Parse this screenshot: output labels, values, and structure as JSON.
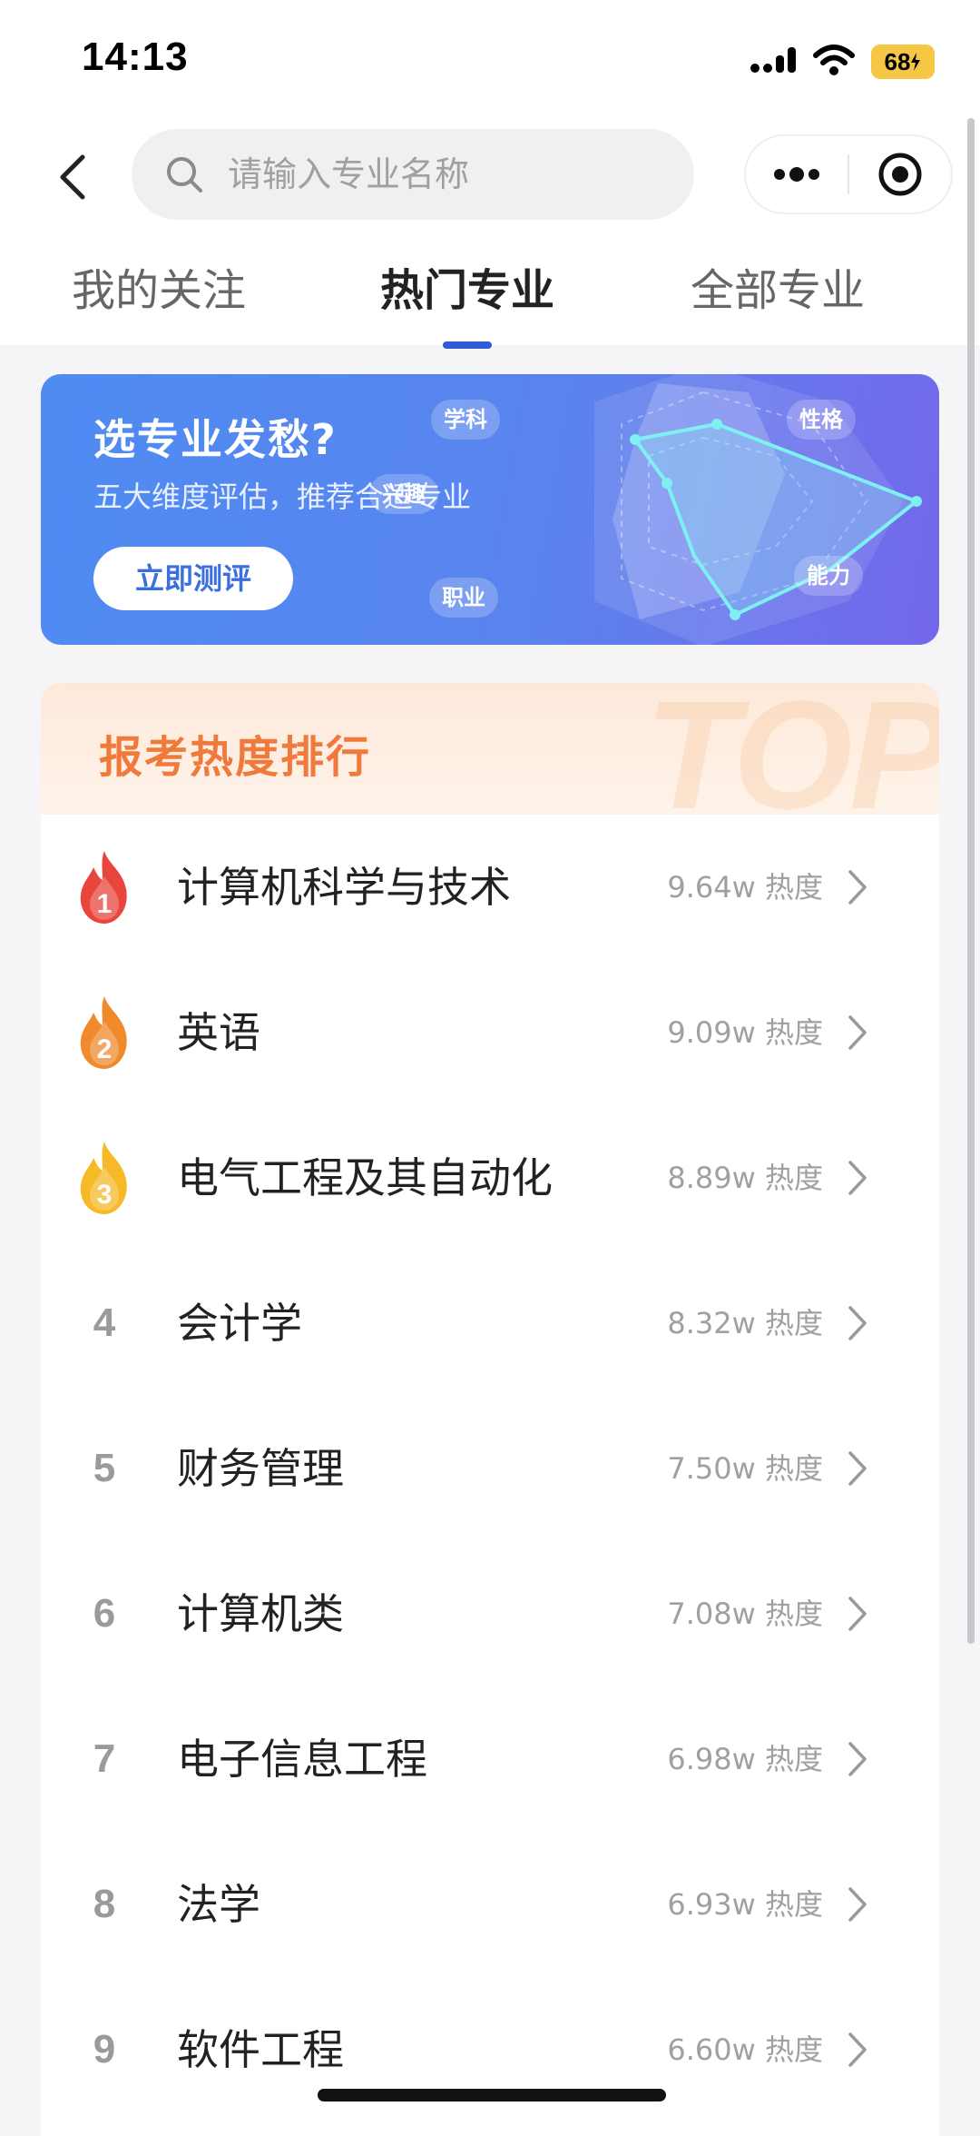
{
  "status_bar": {
    "time": "14:13",
    "battery": "68"
  },
  "search": {
    "placeholder": "请输入专业名称"
  },
  "tabs": [
    {
      "label": "我的关注",
      "active": false
    },
    {
      "label": "热门专业",
      "active": true
    },
    {
      "label": "全部专业",
      "active": false
    }
  ],
  "banner": {
    "title": "选专业发愁?",
    "subtitle": "五大维度评估，推荐合适专业",
    "button": "立即测评",
    "radar_labels": [
      "学科",
      "性格",
      "兴趣",
      "能力",
      "职业"
    ]
  },
  "ranking": {
    "title": "报考热度排行",
    "watermark": "TOP",
    "heat_suffix": "热度",
    "items": [
      {
        "rank": "1",
        "name": "计算机科学与技术",
        "heat": "9.64w 热度"
      },
      {
        "rank": "2",
        "name": "英语",
        "heat": "9.09w 热度"
      },
      {
        "rank": "3",
        "name": "电气工程及其自动化",
        "heat": "8.89w 热度"
      },
      {
        "rank": "4",
        "name": "会计学",
        "heat": "8.32w 热度"
      },
      {
        "rank": "5",
        "name": "财务管理",
        "heat": "7.50w 热度"
      },
      {
        "rank": "6",
        "name": "计算机类",
        "heat": "7.08w 热度"
      },
      {
        "rank": "7",
        "name": "电子信息工程",
        "heat": "6.98w 热度"
      },
      {
        "rank": "8",
        "name": "法学",
        "heat": "6.93w 热度"
      },
      {
        "rank": "9",
        "name": "软件工程",
        "heat": "6.60w 热度"
      }
    ]
  },
  "colors": {
    "accent": "#2f5bd6",
    "rank_title": "#ef7a3c",
    "flame_1": "#e8453c",
    "flame_2": "#f08a2c",
    "flame_3": "#f6b928"
  }
}
